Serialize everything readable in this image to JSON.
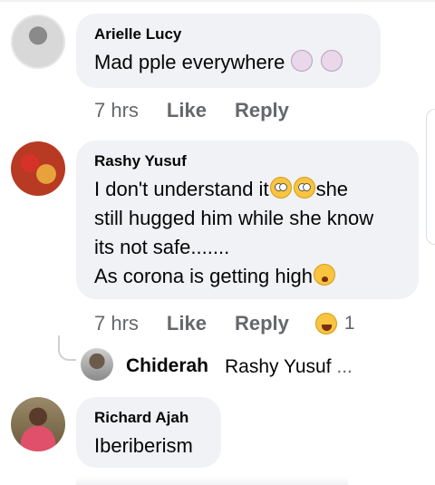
{
  "comments": [
    {
      "author": "Arielle Lucy",
      "text": "Mad pple everywhere",
      "emojis": [
        "woman-facepalming",
        "woman-facepalming"
      ],
      "time": "7 hrs",
      "like_label": "Like",
      "reply_label": "Reply"
    },
    {
      "author": "Rashy Yusuf",
      "text_line1": "I don't understand it",
      "text_line1_end": "she",
      "text_line2": "still hugged him while she know",
      "text_line3": "its not safe.......",
      "text_line4": "As corona is getting high",
      "emojis": [
        "face-with-rolling-eyes",
        "face-with-rolling-eyes",
        "worried-face"
      ],
      "time": "7 hrs",
      "like_label": "Like",
      "reply_label": "Reply",
      "reaction_icon": "haha-reaction",
      "reaction_count": "1",
      "reply_preview": {
        "author": "Chiderah",
        "text": "Rashy Yusuf",
        "more": "..."
      }
    },
    {
      "author": "Richard Ajah",
      "text": "Iberiberism"
    }
  ]
}
